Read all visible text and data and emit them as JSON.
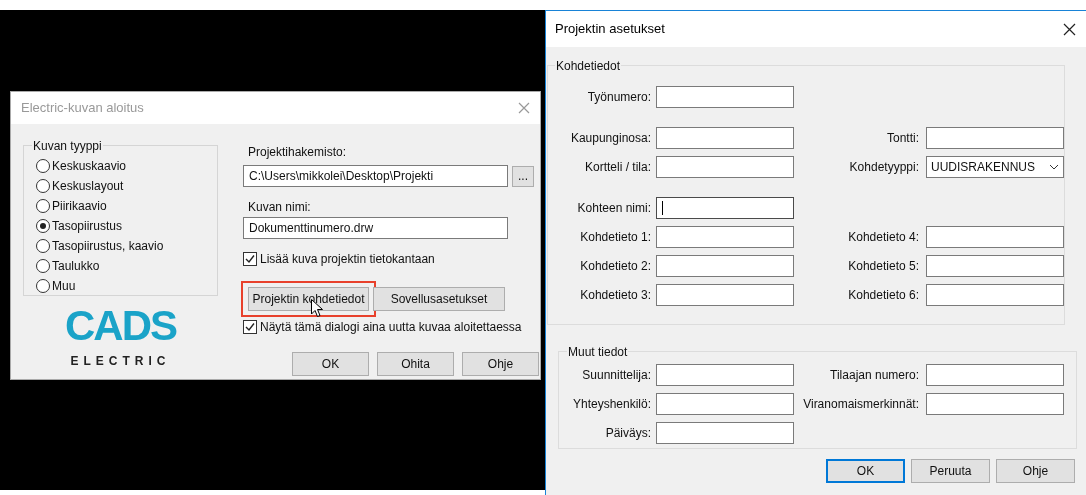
{
  "start_dialog": {
    "title": "Electric-kuvan aloitus",
    "drawing_type": {
      "legend": "Kuvan tyyppi",
      "options": [
        {
          "label": "Keskuskaavio",
          "selected": false
        },
        {
          "label": "Keskuslayout",
          "selected": false
        },
        {
          "label": "Piirikaavio",
          "selected": false
        },
        {
          "label": "Tasopiirustus",
          "selected": true
        },
        {
          "label": "Tasopiirustus, kaavio",
          "selected": false
        },
        {
          "label": "Taulukko",
          "selected": false
        },
        {
          "label": "Muu",
          "selected": false
        }
      ]
    },
    "logo": {
      "wordmark": "CADS",
      "subtitle": "ELECTRIC"
    },
    "project_dir": {
      "label": "Projektihakemisto:",
      "value": "C:\\Users\\mikkolei\\Desktop\\Projekti"
    },
    "browse_button": "...",
    "drawing_name": {
      "label": "Kuvan nimi:",
      "value": "Dokumenttinumero.drw"
    },
    "add_to_db": {
      "label": "Lisää kuva projektin tietokantaan",
      "checked": true
    },
    "action_buttons": [
      {
        "label": "Projektin kohdetiedot",
        "highlighted": true
      },
      {
        "label": "Sovellusasetukset",
        "highlighted": false
      }
    ],
    "show_dialog": {
      "label": "Näytä tämä dialogi aina uutta kuvaa aloitettaessa",
      "checked": true
    },
    "buttons": [
      {
        "label": "OK"
      },
      {
        "label": "Ohita"
      },
      {
        "label": "Ohje"
      }
    ]
  },
  "settings_dialog": {
    "title": "Projektin asetukset",
    "target_info": {
      "legend": "Kohdetiedot",
      "blocks": [
        [
          {
            "left": {
              "label": "Työnumero:",
              "kind": "text",
              "focused": false
            }
          }
        ],
        [
          {
            "left": {
              "label": "Kaupunginosa:",
              "kind": "text",
              "focused": false
            },
            "right": {
              "label": "Tontti:",
              "kind": "text",
              "focused": false
            }
          },
          {
            "left": {
              "label": "Kortteli / tila:",
              "kind": "text",
              "focused": false
            },
            "right": {
              "label": "Kohdetyyppi:",
              "kind": "dropdown",
              "value": "UUDISRAKENNUS"
            }
          }
        ],
        [
          {
            "left": {
              "label": "Kohteen nimi:",
              "kind": "text",
              "focused": true
            }
          },
          {
            "left": {
              "label": "Kohdetieto 1:",
              "kind": "text",
              "focused": false
            },
            "right": {
              "label": "Kohdetieto 4:",
              "kind": "text",
              "focused": false
            }
          },
          {
            "left": {
              "label": "Kohdetieto 2:",
              "kind": "text",
              "focused": false
            },
            "right": {
              "label": "Kohdetieto 5:",
              "kind": "text",
              "focused": false
            }
          },
          {
            "left": {
              "label": "Kohdetieto 3:",
              "kind": "text",
              "focused": false
            },
            "right": {
              "label": "Kohdetieto 6:",
              "kind": "text",
              "focused": false
            }
          }
        ]
      ]
    },
    "other_info": {
      "legend": "Muut tiedot",
      "rows": [
        {
          "left": {
            "label": "Suunnittelija:",
            "kind": "text",
            "focused": false
          },
          "right": {
            "label": "Tilaajan numero:",
            "kind": "text",
            "focused": false
          }
        },
        {
          "left": {
            "label": "Yhteyshenkilö:",
            "kind": "text",
            "focused": false
          },
          "right": {
            "label": "Viranomaismerkinnät:",
            "kind": "text",
            "focused": false
          }
        },
        {
          "left": {
            "label": "Päiväys:",
            "kind": "text",
            "focused": false
          }
        }
      ]
    },
    "buttons": [
      {
        "label": "OK",
        "default": true
      },
      {
        "label": "Peruuta",
        "default": false
      },
      {
        "label": "Ohje",
        "default": false
      }
    ]
  }
}
